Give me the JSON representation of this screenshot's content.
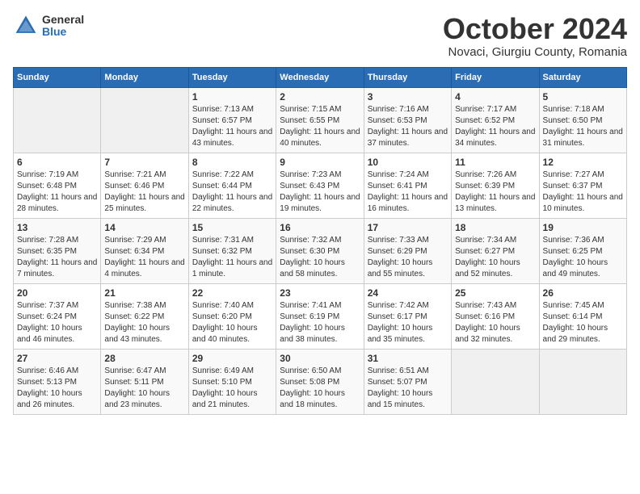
{
  "logo": {
    "general": "General",
    "blue": "Blue"
  },
  "title": "October 2024",
  "location": "Novaci, Giurgiu County, Romania",
  "days_of_week": [
    "Sunday",
    "Monday",
    "Tuesday",
    "Wednesday",
    "Thursday",
    "Friday",
    "Saturday"
  ],
  "weeks": [
    [
      {
        "day": "",
        "info": ""
      },
      {
        "day": "",
        "info": ""
      },
      {
        "day": "1",
        "info": "Sunrise: 7:13 AM\nSunset: 6:57 PM\nDaylight: 11 hours and 43 minutes."
      },
      {
        "day": "2",
        "info": "Sunrise: 7:15 AM\nSunset: 6:55 PM\nDaylight: 11 hours and 40 minutes."
      },
      {
        "day": "3",
        "info": "Sunrise: 7:16 AM\nSunset: 6:53 PM\nDaylight: 11 hours and 37 minutes."
      },
      {
        "day": "4",
        "info": "Sunrise: 7:17 AM\nSunset: 6:52 PM\nDaylight: 11 hours and 34 minutes."
      },
      {
        "day": "5",
        "info": "Sunrise: 7:18 AM\nSunset: 6:50 PM\nDaylight: 11 hours and 31 minutes."
      }
    ],
    [
      {
        "day": "6",
        "info": "Sunrise: 7:19 AM\nSunset: 6:48 PM\nDaylight: 11 hours and 28 minutes."
      },
      {
        "day": "7",
        "info": "Sunrise: 7:21 AM\nSunset: 6:46 PM\nDaylight: 11 hours and 25 minutes."
      },
      {
        "day": "8",
        "info": "Sunrise: 7:22 AM\nSunset: 6:44 PM\nDaylight: 11 hours and 22 minutes."
      },
      {
        "day": "9",
        "info": "Sunrise: 7:23 AM\nSunset: 6:43 PM\nDaylight: 11 hours and 19 minutes."
      },
      {
        "day": "10",
        "info": "Sunrise: 7:24 AM\nSunset: 6:41 PM\nDaylight: 11 hours and 16 minutes."
      },
      {
        "day": "11",
        "info": "Sunrise: 7:26 AM\nSunset: 6:39 PM\nDaylight: 11 hours and 13 minutes."
      },
      {
        "day": "12",
        "info": "Sunrise: 7:27 AM\nSunset: 6:37 PM\nDaylight: 11 hours and 10 minutes."
      }
    ],
    [
      {
        "day": "13",
        "info": "Sunrise: 7:28 AM\nSunset: 6:35 PM\nDaylight: 11 hours and 7 minutes."
      },
      {
        "day": "14",
        "info": "Sunrise: 7:29 AM\nSunset: 6:34 PM\nDaylight: 11 hours and 4 minutes."
      },
      {
        "day": "15",
        "info": "Sunrise: 7:31 AM\nSunset: 6:32 PM\nDaylight: 11 hours and 1 minute."
      },
      {
        "day": "16",
        "info": "Sunrise: 7:32 AM\nSunset: 6:30 PM\nDaylight: 10 hours and 58 minutes."
      },
      {
        "day": "17",
        "info": "Sunrise: 7:33 AM\nSunset: 6:29 PM\nDaylight: 10 hours and 55 minutes."
      },
      {
        "day": "18",
        "info": "Sunrise: 7:34 AM\nSunset: 6:27 PM\nDaylight: 10 hours and 52 minutes."
      },
      {
        "day": "19",
        "info": "Sunrise: 7:36 AM\nSunset: 6:25 PM\nDaylight: 10 hours and 49 minutes."
      }
    ],
    [
      {
        "day": "20",
        "info": "Sunrise: 7:37 AM\nSunset: 6:24 PM\nDaylight: 10 hours and 46 minutes."
      },
      {
        "day": "21",
        "info": "Sunrise: 7:38 AM\nSunset: 6:22 PM\nDaylight: 10 hours and 43 minutes."
      },
      {
        "day": "22",
        "info": "Sunrise: 7:40 AM\nSunset: 6:20 PM\nDaylight: 10 hours and 40 minutes."
      },
      {
        "day": "23",
        "info": "Sunrise: 7:41 AM\nSunset: 6:19 PM\nDaylight: 10 hours and 38 minutes."
      },
      {
        "day": "24",
        "info": "Sunrise: 7:42 AM\nSunset: 6:17 PM\nDaylight: 10 hours and 35 minutes."
      },
      {
        "day": "25",
        "info": "Sunrise: 7:43 AM\nSunset: 6:16 PM\nDaylight: 10 hours and 32 minutes."
      },
      {
        "day": "26",
        "info": "Sunrise: 7:45 AM\nSunset: 6:14 PM\nDaylight: 10 hours and 29 minutes."
      }
    ],
    [
      {
        "day": "27",
        "info": "Sunrise: 6:46 AM\nSunset: 5:13 PM\nDaylight: 10 hours and 26 minutes."
      },
      {
        "day": "28",
        "info": "Sunrise: 6:47 AM\nSunset: 5:11 PM\nDaylight: 10 hours and 23 minutes."
      },
      {
        "day": "29",
        "info": "Sunrise: 6:49 AM\nSunset: 5:10 PM\nDaylight: 10 hours and 21 minutes."
      },
      {
        "day": "30",
        "info": "Sunrise: 6:50 AM\nSunset: 5:08 PM\nDaylight: 10 hours and 18 minutes."
      },
      {
        "day": "31",
        "info": "Sunrise: 6:51 AM\nSunset: 5:07 PM\nDaylight: 10 hours and 15 minutes."
      },
      {
        "day": "",
        "info": ""
      },
      {
        "day": "",
        "info": ""
      }
    ]
  ]
}
